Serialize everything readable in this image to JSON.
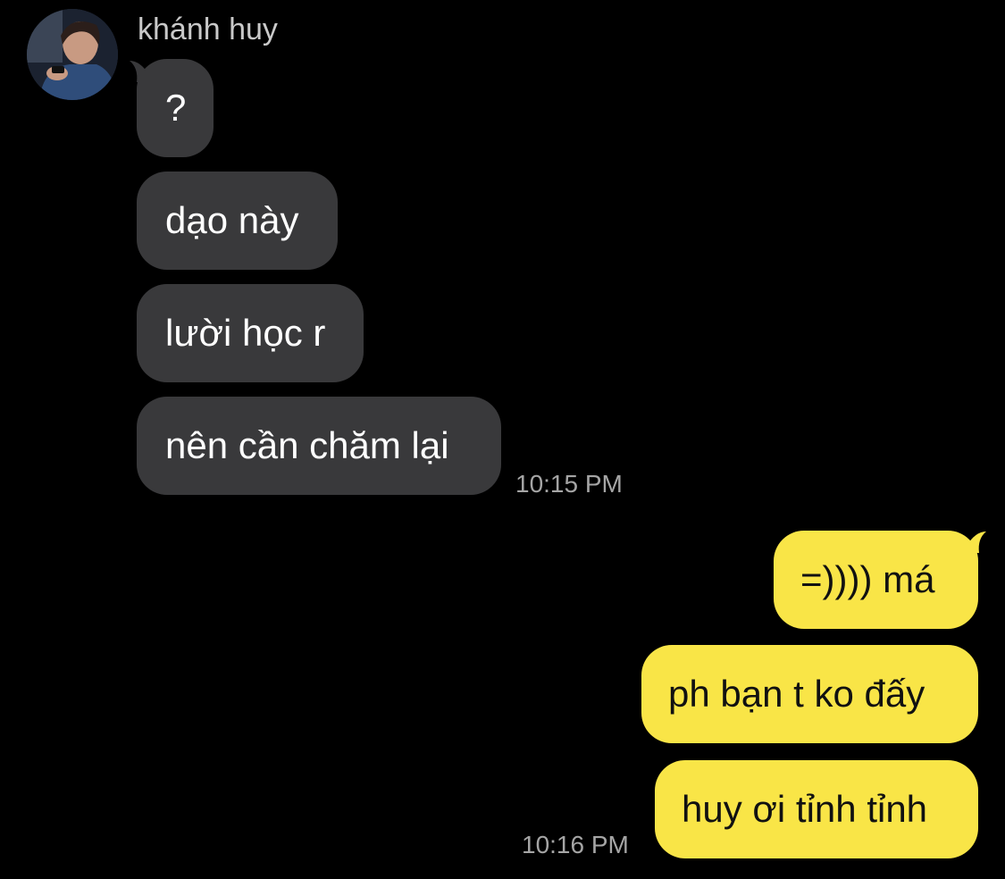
{
  "chat": {
    "sender_name": "khánh huy",
    "incoming_messages": [
      "?",
      "dạo này",
      "lười học r",
      "nên cần chăm lại"
    ],
    "incoming_time": "10:15 PM",
    "outgoing_messages": [
      "=)))) má",
      "ph bạn t ko đấy",
      "huy ơi tỉnh tỉnh"
    ],
    "outgoing_time": "10:16 PM"
  },
  "colors": {
    "background": "#000000",
    "incoming_bubble": "#39393b",
    "outgoing_bubble": "#f9e547",
    "timestamp": "#a5a5a5"
  },
  "icons": {
    "avatar": "profile-photo-avatar"
  }
}
